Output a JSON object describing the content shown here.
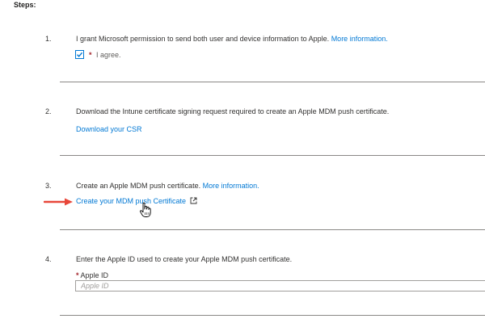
{
  "page": {
    "steps_heading": "Steps:"
  },
  "steps": [
    {
      "number": "1.",
      "text": "I grant Microsoft permission to send both user and device information to Apple.",
      "link": "More information.",
      "checkbox": {
        "checked": true,
        "required_marker": "*",
        "label": "I agree."
      }
    },
    {
      "number": "2.",
      "text": "Download the Intune certificate signing request required to create an Apple MDM push certificate.",
      "action_link": "Download your CSR"
    },
    {
      "number": "3.",
      "text": "Create an Apple MDM push certificate.",
      "link": "More information.",
      "action_link": "Create your MDM push Certificate"
    },
    {
      "number": "4.",
      "text": "Enter the Apple ID used to create your Apple MDM push certificate.",
      "field": {
        "required_marker": "*",
        "label": "Apple ID",
        "value": "",
        "placeholder": "Apple ID"
      }
    }
  ],
  "colors": {
    "link": "#0078d4",
    "required": "#a4262c",
    "divider": "#8a8886",
    "arrow": "#e8473a"
  },
  "icons": {
    "checkbox_check": "checkmark-icon",
    "external_link": "external-link-icon",
    "annotation_arrow": "red-arrow-icon",
    "mouse_cursor": "hand-cursor-icon"
  }
}
